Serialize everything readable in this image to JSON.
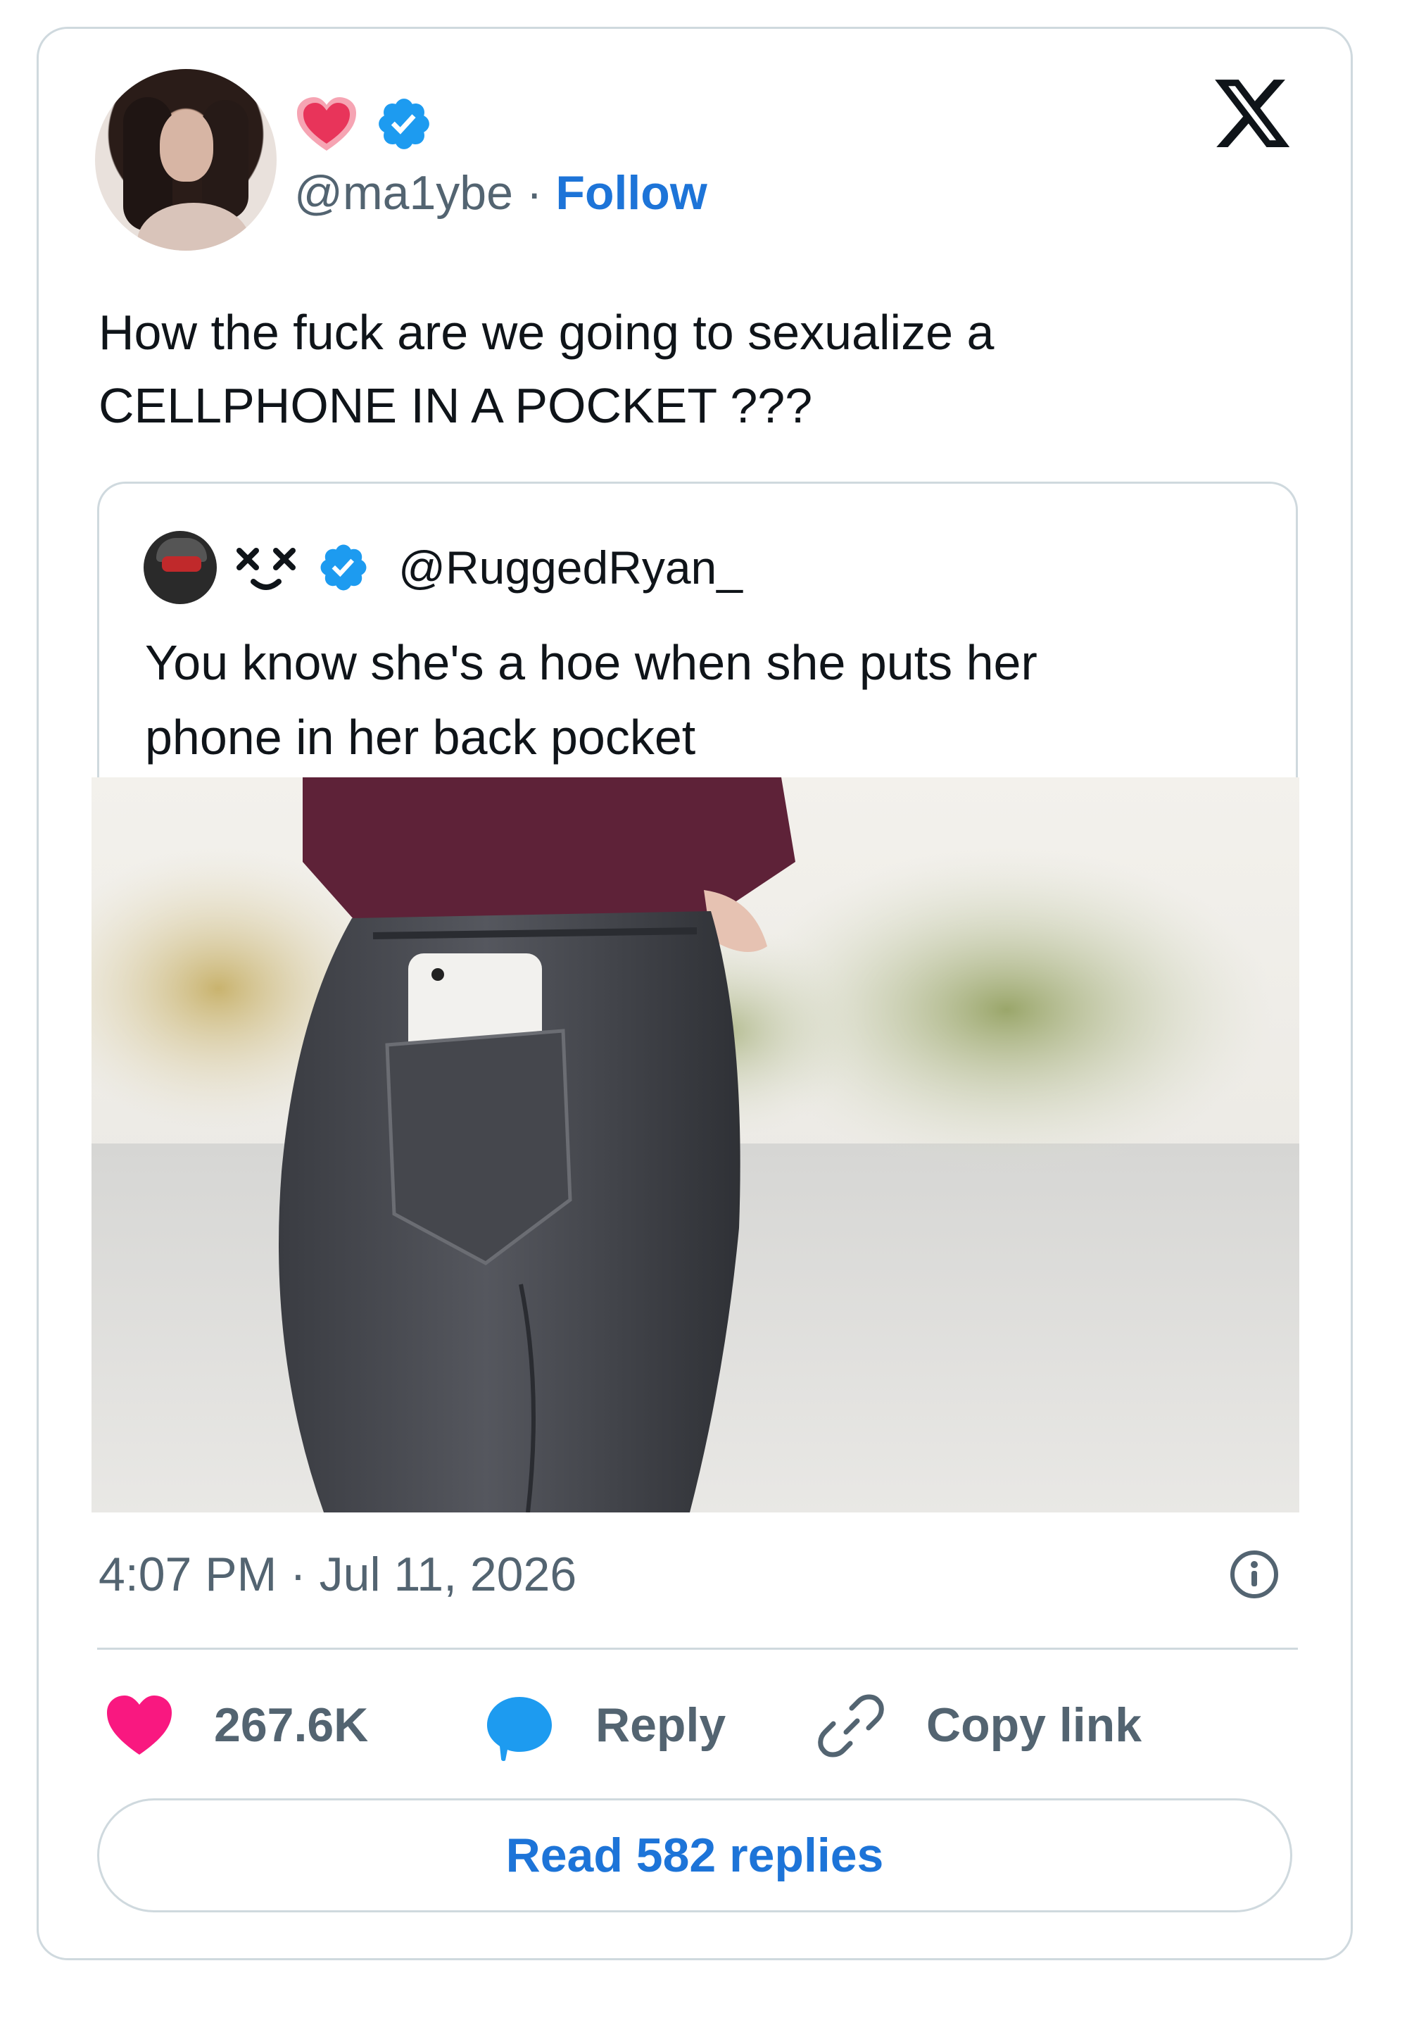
{
  "author": {
    "handle": "@ma1ybe",
    "separator": "·",
    "follow_label": "Follow"
  },
  "tweet": {
    "text_line1": "How the fuck are we going to sexualize a",
    "text_line2": "CELLPHONE IN A POCKET ???"
  },
  "quote": {
    "emoji_name": "xx",
    "handle": "@RuggedRyan_",
    "text_line1": "You know she's a hoe when she puts her",
    "text_line2": "phone in her back pocket"
  },
  "meta": {
    "timestamp": "4:07 PM · Jul 11, 2026"
  },
  "actions": {
    "likes": "267.6K",
    "reply_label": "Reply",
    "copy_link_label": "Copy link"
  },
  "footer": {
    "read_replies_label": "Read 582 replies"
  },
  "colors": {
    "accent_blue": "#1d74d8",
    "like_pink": "#f91880",
    "muted": "#536471",
    "border": "#cfd9de"
  },
  "icons": [
    "heart-badge-icon",
    "verified-icon",
    "x-logo-icon",
    "info-icon",
    "like-icon",
    "reply-icon",
    "link-icon"
  ]
}
